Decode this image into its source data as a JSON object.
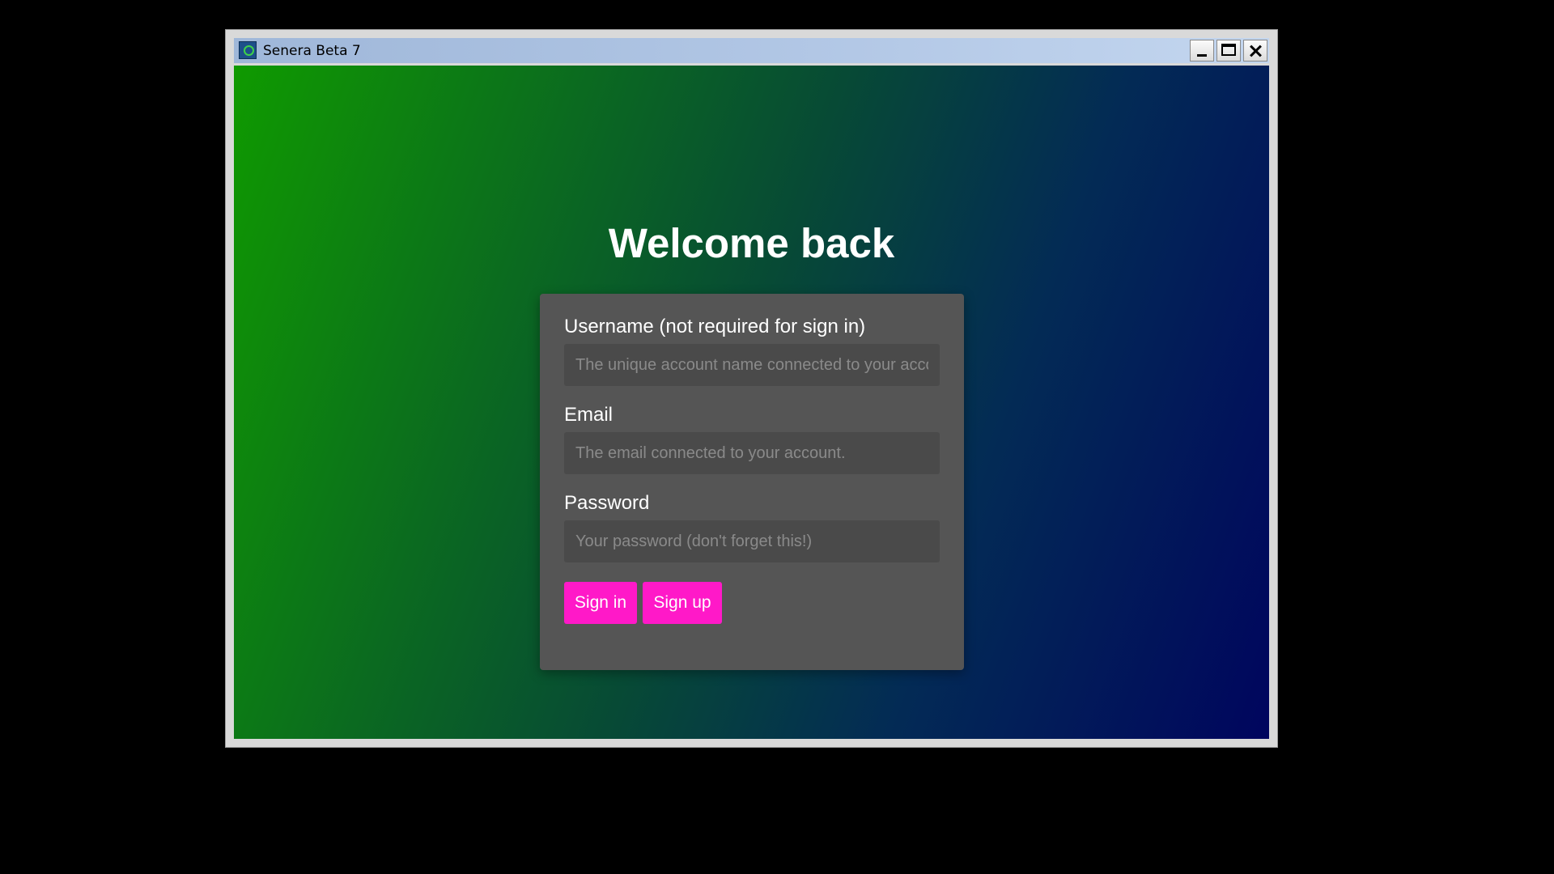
{
  "window": {
    "title": "Senera Beta 7",
    "icon": "senera-app-icon",
    "controls": {
      "minimize": "minimize-icon",
      "maximize": "maximize-icon",
      "close": "close-icon"
    }
  },
  "page": {
    "heading": "Welcome back",
    "background_gradient": [
      "#0f9a00",
      "#074a35",
      "#00055e"
    ]
  },
  "form": {
    "username": {
      "label": "Username (not required for sign in)",
      "value": "",
      "placeholder": "The unique account name connected to your account."
    },
    "email": {
      "label": "Email",
      "value": "",
      "placeholder": "The email connected to your account."
    },
    "password": {
      "label": "Password",
      "value": "",
      "placeholder": "Your password (don't forget this!)"
    },
    "buttons": {
      "sign_in": "Sign in",
      "sign_up": "Sign up"
    }
  },
  "colors": {
    "card": "#555555",
    "input": "#4a4a4a",
    "accent": "#ff19c8",
    "text": "#ffffff"
  }
}
